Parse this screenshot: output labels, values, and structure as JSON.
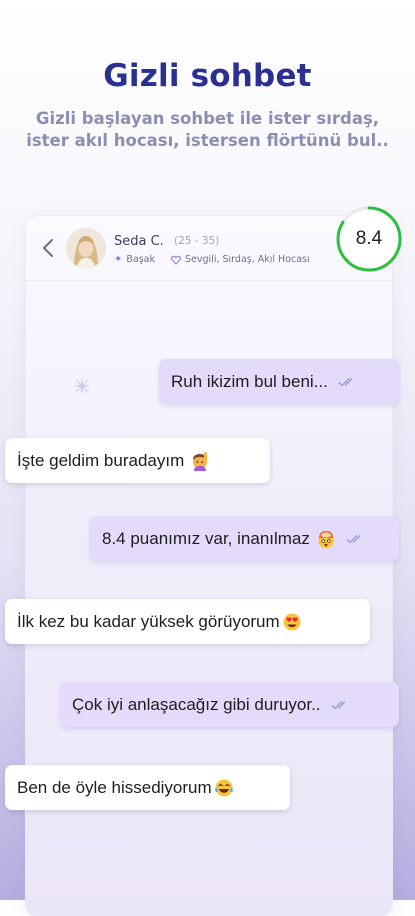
{
  "headline": "Gizli sohbet",
  "subline": "Gizli başlayan sohbet ile ister sırdaş, ister akıl hocası, istersen flörtünü bul..",
  "chat": {
    "name": "Seda C.",
    "age_range": "(25 - 35)",
    "zodiac": "Başak",
    "interests": "Sevgili, Sırdaş, Akıl Hocası",
    "score": "8.4",
    "score_fraction": 0.84
  },
  "messages": [
    {
      "side": "out",
      "text": "Ruh ikizim bul beni...",
      "emoji": ""
    },
    {
      "side": "in",
      "text": "İşte geldim buradayım",
      "emoji": "person-raising-hand"
    },
    {
      "side": "out",
      "text": "8.4 puanımız var, inanılmaz",
      "emoji": "face-with-exploding-head"
    },
    {
      "side": "in",
      "text": "İlk kez bu kadar yüksek görüyorum",
      "emoji": "smiling-face-with-heart-eyes"
    },
    {
      "side": "out",
      "text": "Çok iyi anlaşacağız gibi duruyor..",
      "emoji": ""
    },
    {
      "side": "in",
      "text": "Ben de öyle hissediyorum",
      "emoji": "face-with-tears-of-joy"
    }
  ],
  "colors": {
    "headline": "#2a2f92",
    "outgoing_bubble": "#e4dbfa",
    "incoming_bubble": "#ffffff",
    "score_ring": "#2bbf3f",
    "read_ticks": "#8f9bd6"
  }
}
